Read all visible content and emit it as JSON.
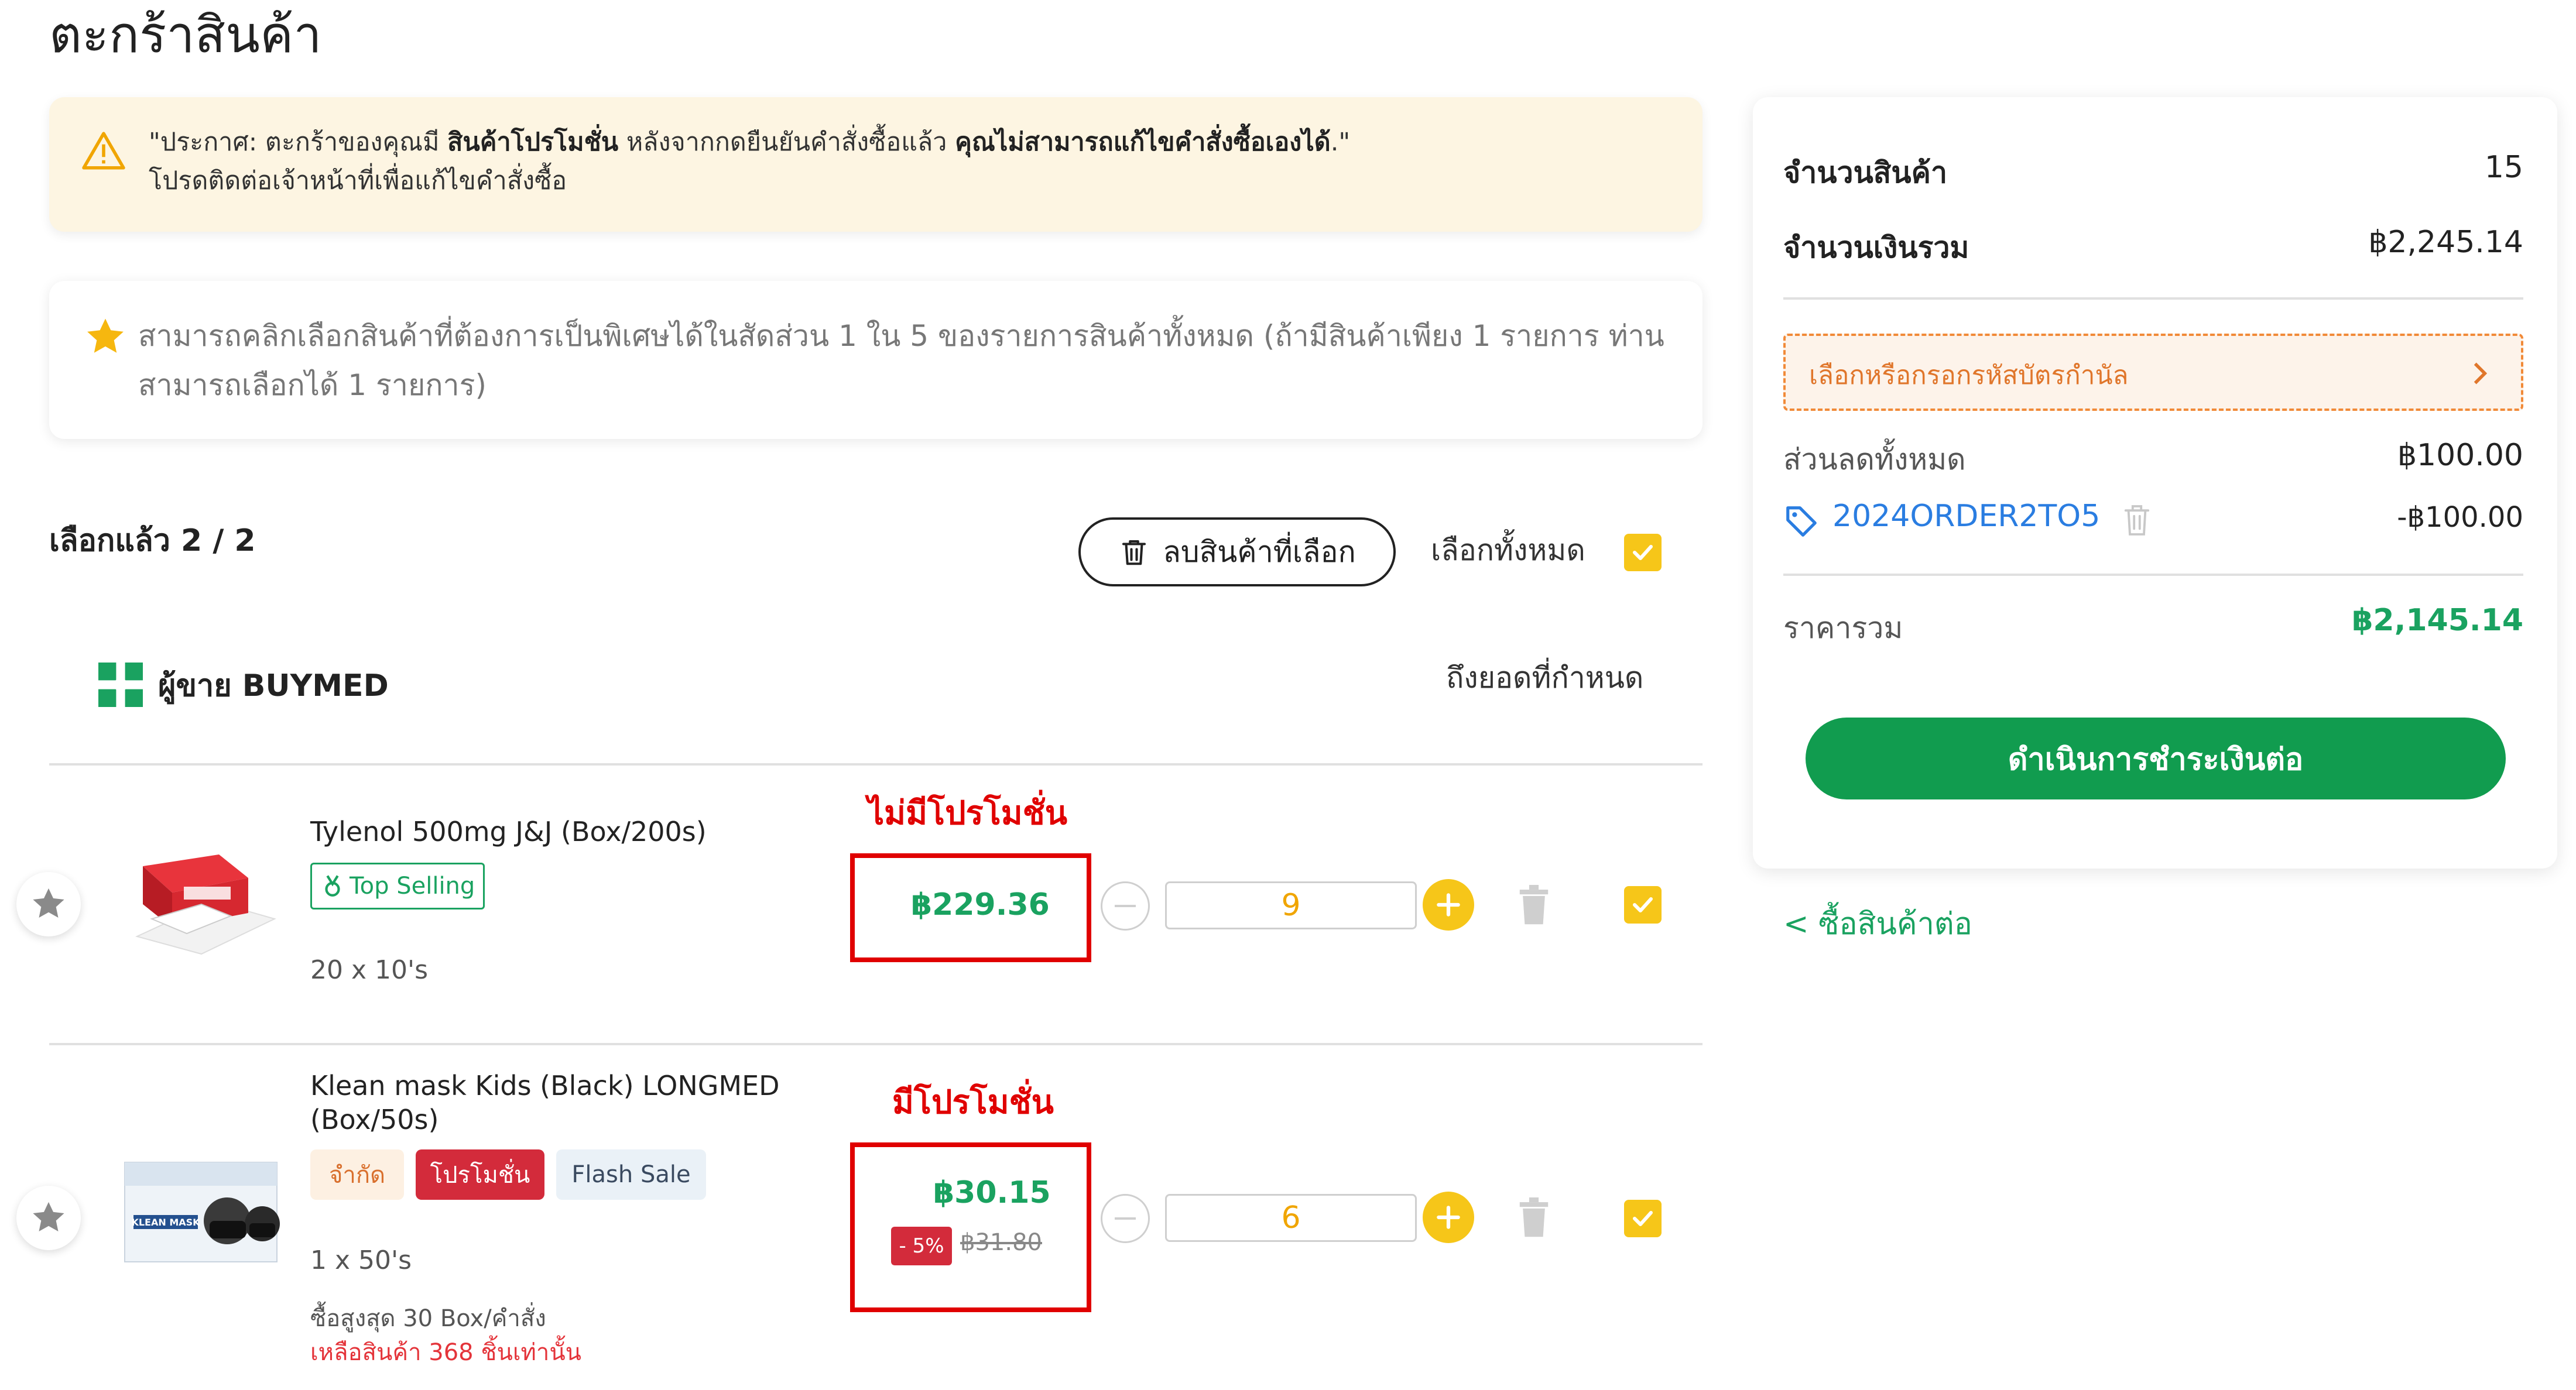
{
  "page": {
    "title": "ตะกร้าสินค้า"
  },
  "notice": {
    "prefix": "\"ประกาศ: ตะกร้าของคุณมี ",
    "bold1": "สินค้าโปรโมชั่น",
    "middle": " หลังจากกดยืนยันคำสั่งซื้อแล้ว ",
    "bold2": "คุณไม่สามารถแก้ไขคำสั่งซื้อเองได้",
    "suffix": ".\"",
    "line2": "โปรดติดต่อเจ้าหน้าที่เพื่อแก้ไขคำสั่งซื้อ"
  },
  "tip": {
    "text": "สามารถคลิกเลือกสินค้าที่ต้องการเป็นพิเศษได้ในสัดส่วน 1 ใน 5 ของรายการสินค้าทั้งหมด (ถ้ามีสินค้าเพียง 1 รายการ ท่านสามารถเลือกได้ 1 รายการ)"
  },
  "toolbar": {
    "selected_count": "เลือกแล้ว 2 / 2",
    "delete_selected": "ลบสินค้าที่เลือก",
    "select_all": "เลือกทั้งหมด"
  },
  "seller": {
    "name": "ผู้ขาย BUYMED",
    "note": "ถึงยอดที่กำหนด"
  },
  "items": [
    {
      "name": "Tylenol 500mg J&J (Box/200s)",
      "badge": "Top Selling",
      "pack": "20  x  10's",
      "annotation": "ไม่มีโปรโมชั่น",
      "price": "฿229.36",
      "qty": "9"
    },
    {
      "name_line1": "Klean mask Kids (Black) LONGMED",
      "name_line2": "(Box/50s)",
      "tags": [
        "จำกัด",
        "โปรโมชั่น",
        "Flash Sale"
      ],
      "pack": "1  x  50's",
      "limit": "ซื้อสูงสุด 30 Box/คำสั่ง",
      "stock": "เหลือสินค้า 368 ชิ้นเท่านั้น",
      "annotation": "มีโปรโมชั่น",
      "price": "฿30.15",
      "discount": "- 5%",
      "old_price": "฿31.80",
      "qty": "6",
      "img_text": "KLEAN MASK"
    }
  ],
  "summary": {
    "item_count_label": "จำนวนสินค้า",
    "item_count": "15",
    "total_label": "จำนวนเงินรวม",
    "total": "฿2,245.14",
    "voucher_label": "เลือกหรือกรอกรหัสบัตรกำนัล",
    "discount_label": "ส่วนลดทั้งหมด",
    "discount": "฿100.00",
    "coupon_code": "2024ORDER2TO5",
    "coupon_value": "-฿100.00",
    "grand_label": "ราคารวม",
    "grand_total": "฿2,145.14",
    "checkout": "ดำเนินการชำระเงินต่อ",
    "continue": "< ซื้อสินค้าต่อ"
  },
  "colors": {
    "accent_green": "#1aa260",
    "checkbox_yellow": "#f6c619",
    "annotation_red": "#e00000"
  }
}
